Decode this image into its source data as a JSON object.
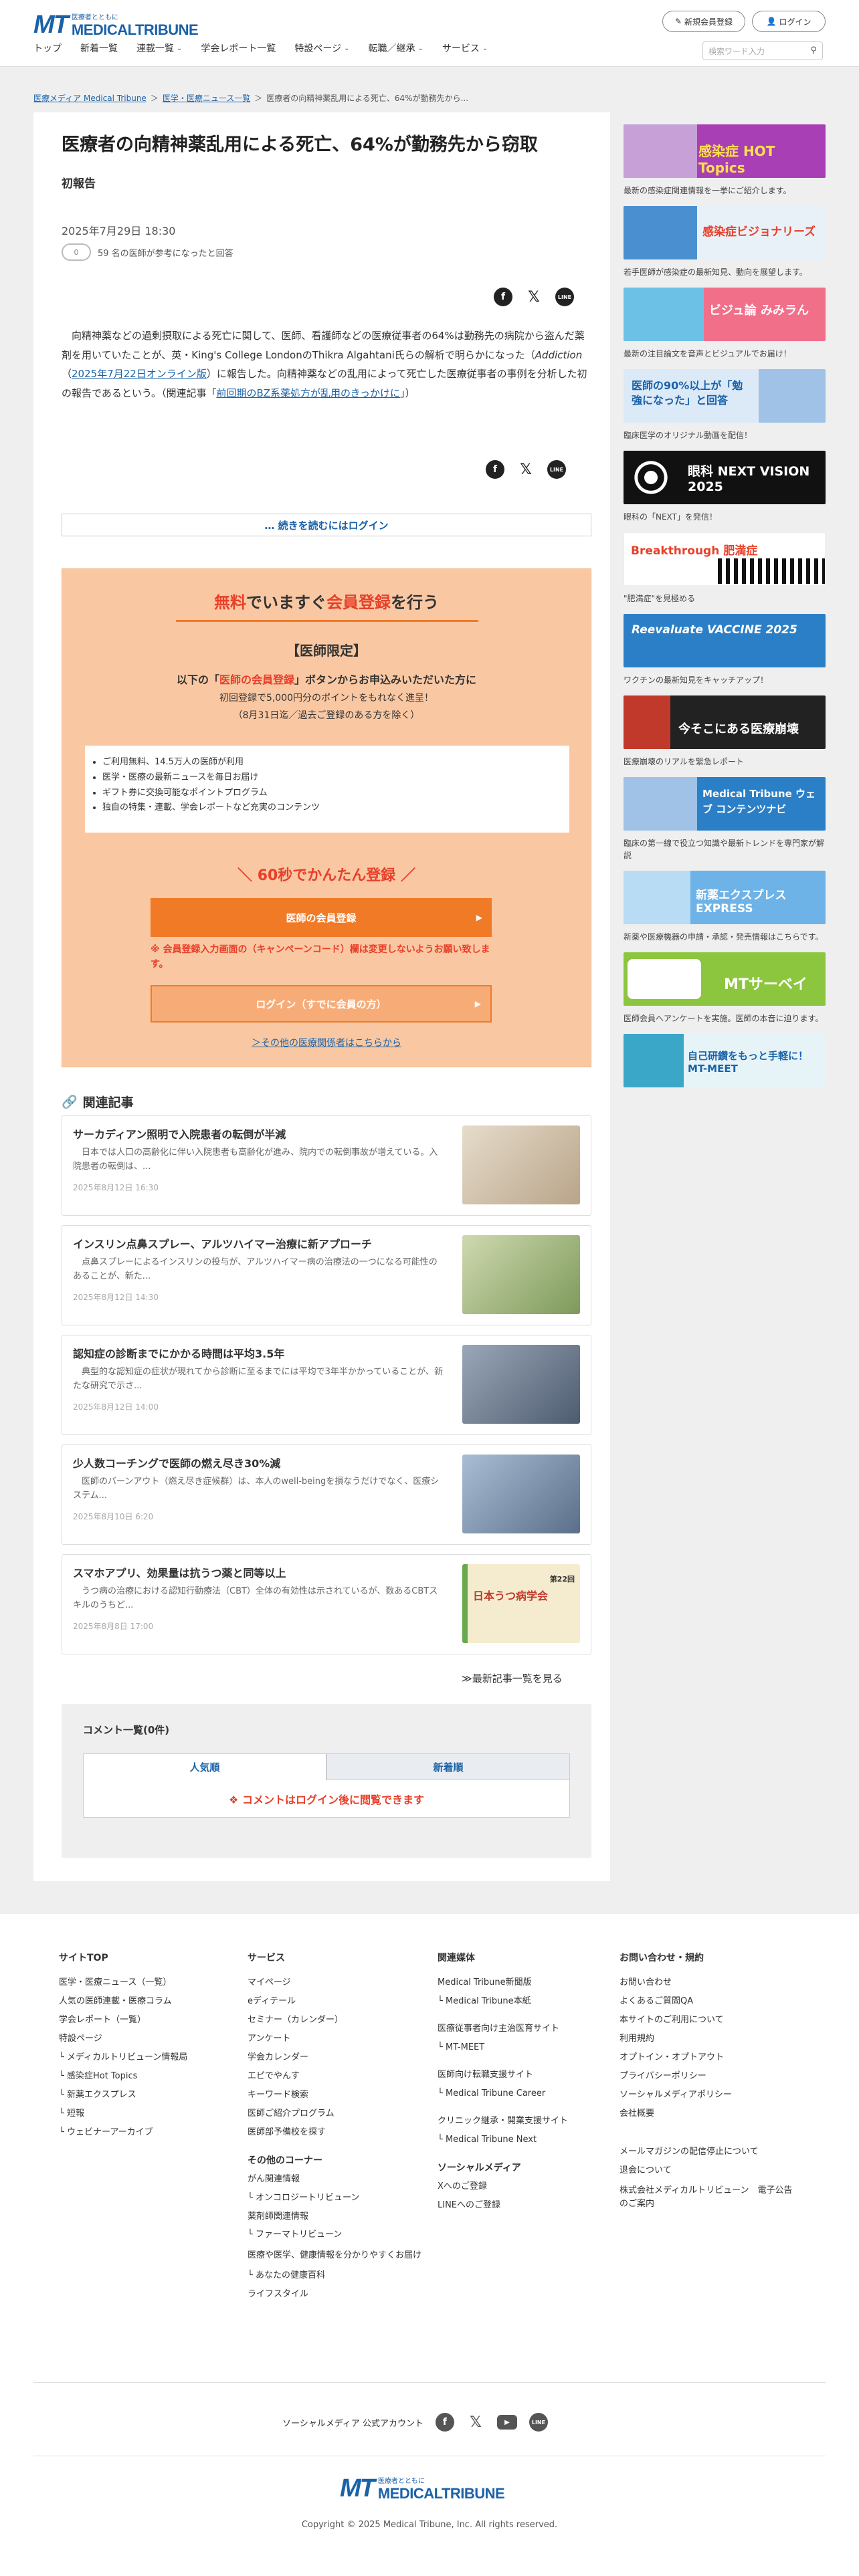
{
  "header": {
    "logo_small": "医療者とともに",
    "logo_mt": "MT",
    "logo_main": "MEDICALTRIBUNE",
    "register_btn": "新規会員登録",
    "login_btn": "ログイン",
    "nav": [
      {
        "label": "トップ",
        "dropdown": false
      },
      {
        "label": "新着一覧",
        "dropdown": false
      },
      {
        "label": "連載一覧",
        "dropdown": true
      },
      {
        "label": "学会レポート一覧",
        "dropdown": false
      },
      {
        "label": "特設ページ",
        "dropdown": true
      },
      {
        "label": "転職／継承",
        "dropdown": true
      },
      {
        "label": "サービス",
        "dropdown": true
      }
    ],
    "search_placeholder": "検索ワード入力",
    "chevron": "⌄"
  },
  "breadcrumb": [
    "医療メディア Medical Tribune",
    "医学・医療ニュース一覧",
    "医療者の向精神薬乱用による死亡、64%が勤務先から..."
  ],
  "breadcrumb_sep": "＞",
  "article": {
    "title": "医療者の向精神薬乱用による死亡、64%が勤務先から窃取",
    "subtitle": "初報告",
    "date": "2025年7月29日 18:30",
    "toggle": "0",
    "reference": "59 名の医師が参考になったと回答",
    "body_1": "向精神薬などの過剰摂取による死亡に関して、医師、看護師などの医療従事者の64%は勤務先の病院から盗んだ薬剤を用いていたことが、英・King's College LondonのThikra Algahtani氏らの解析で明らかになった",
    "body_journal": "Addiction",
    "body_link1": "2025年7月22日オンライン版",
    "body_2": "に報告した。向精神薬などの乱用によって死亡した医療従事者の事例を分析した初の報告であるという。（関連記事「",
    "body_link2": "前回期のBZ系薬処方が乱用のきっかけに",
    "body_3": "」）",
    "read_more_pre": "… 続きを読むには",
    "read_more_link": "ログイン"
  },
  "share": {
    "fb": "f",
    "x": "𝕏",
    "line": "LINE"
  },
  "register": {
    "title_a": "無料",
    "title_b": "でいますぐ",
    "title_c": "会員登録",
    "title_d": "を行う",
    "limited": "【医師限定】",
    "cta_a": "以下の「",
    "cta_b": "医師の会員登録",
    "cta_c": "」ボタンからお申込みいただいた方に",
    "bonus": "初回登録で5,000円分のポイントをもれなく進呈！",
    "period": "（8月31日迄／過去ご登録のある方を除く）",
    "benefits": [
      "ご利用無料、14.5万人の医師が利用",
      "医学・医療の最新ニュースを毎日お届け",
      "ギフト券に交換可能なポイントプログラム",
      "独自の特集・連載、学会レポートなど充実のコンテンツ"
    ],
    "quick": "＼ 60秒でかんたん登録 ／",
    "reg_button": "医師の会員登録",
    "note": "※ 会員登録入力画面の（キャンペーンコード）欄は変更しないようお願い致します。",
    "login_button": "ログイン（すでに会員の方）",
    "other_link": "＞その他の医療関係者はこちらから",
    "arrow": "▶"
  },
  "related": {
    "heading": "関連記事",
    "icon": "🔗",
    "items": [
      {
        "title": "サーカディアン照明で入院患者の転倒が半減",
        "summary": "日本では人口の高齢化に伴い入院患者も高齢化が進み、院内での転倒事故が増えている。入院患者の転倒は、...",
        "date": "2025年8月12日 16:30",
        "color": "#d8c5a8"
      },
      {
        "title": "インスリン点鼻スプレー、アルツハイマー治療に新アプローチ",
        "summary": "点鼻スプレーによるインスリンの投与が、アルツハイマー病の治療法の一つになる可能性のあることが、新た...",
        "date": "2025年8月12日 14:30",
        "color": "#a9b88a"
      },
      {
        "title": "認知症の診断までにかかる時間は平均3.5年",
        "summary": "典型的な認知症の症状が現れてから診断に至るまでには平均で3年半かかっていることが、新たな研究で示さ...",
        "date": "2025年8月12日 14:00",
        "color": "#6f7f95"
      },
      {
        "title": "少人数コーチングで医師の燃え尽き30%減",
        "summary": "医師のバーンアウト（燃え尽き症候群）は、本人のwell-beingを損なうだけでなく、医療システム...",
        "date": "2025年8月10日 6:20",
        "color": "#7a8ea8"
      },
      {
        "title": "スマホアプリ、効果量は抗うつ薬と同等以上",
        "summary": "うつ病の治療における認知行動療法（CBT）全体の有効性は示されているが、数あるCBTスキルのうちど...",
        "date": "2025年8月8日 17:00",
        "color": "#f3ead0"
      }
    ],
    "img5_title": "第22回",
    "img5_main": "日本うつ病学会",
    "more": "≫最新記事一覧を見る"
  },
  "comments": {
    "heading": "コメント一覧(0件)",
    "tab_popular": "人気順",
    "tab_new": "新着順",
    "login_msg": "❖ コメントはログイン後に閲覧できます"
  },
  "sidebar": [
    {
      "title": "感染症 HOT Topics",
      "caption": "最新の感染症関連情報を一挙にご紹介します。",
      "bg": "#a83fb5",
      "fg": "#ffffff"
    },
    {
      "title": "感染症ビジョナリーズ",
      "caption": "若手医師が感染症の最新知見、動向を展望します。",
      "bg": "#e9f1f8",
      "fg": "#e8402a"
    },
    {
      "title": "ビジュ論 みみラん",
      "caption": "最新の注目論文を音声とビジュアルでお届け！",
      "bg": "#f26f8a",
      "fg": "#ffffff"
    },
    {
      "title": "医師の90%以上が「勉強になった」と回答",
      "caption": "臨床医学のオリジナル動画を配信！",
      "bg": "#dceaf8",
      "fg": "#1a62a8"
    },
    {
      "title": "眼科 NEXT VISION 2025",
      "caption": "眼科の「NEXT」を発信！",
      "bg": "#111111",
      "fg": "#ffffff"
    },
    {
      "title": "Breakthrough 肥満症",
      "caption": "\"肥満症\"を見極める",
      "bg": "#ffffff",
      "fg": "#e8402a"
    },
    {
      "title": "Reevaluate VACCINE 2025",
      "caption": "ワクチンの最新知見をキャッチアップ！",
      "bg": "#2b7fc6",
      "fg": "#ffffff"
    },
    {
      "title": "今そこにある医療崩壊",
      "caption": "医療崩壊のリアルを緊急レポート",
      "bg": "#222222",
      "fg": "#ffffff"
    },
    {
      "title": "Medical Tribune ウェブ コンテンツナビ",
      "caption": "臨床の第一線で役立つ知識や最新トレンドを専門家が解説",
      "bg": "#2b7fc6",
      "fg": "#ffffff"
    },
    {
      "title": "新薬エクスプレス EXPRESS",
      "caption": "新薬や医療機器の申請・承認・発売情報はこちらです。",
      "bg": "#6db3e8",
      "fg": "#ffffff"
    },
    {
      "title": "MTサーベイ",
      "caption": "医師会員へアンケートを実施。医師の本音に迫ります。",
      "bg": "#8cc63f",
      "fg": "#ffffff"
    },
    {
      "title": "自己研鑽をもっと手軽に！ MT-MEET",
      "caption": "",
      "bg": "#e6f4f8",
      "fg": "#1a62a8"
    }
  ],
  "footer": {
    "col1": {
      "heading": "サイトTOP",
      "items": [
        "医学・医療ニュース（一覧）",
        "人気の医師連載・医療コラム",
        "学会レポート（一覧）",
        "特設ページ",
        "└ メディカルトリビューン情報局",
        "└ 感染症Hot Topics",
        "└ 新薬エクスプレス",
        "└ 短報",
        "└ ウェビナーアーカイブ"
      ]
    },
    "col2": {
      "heading": "サービス",
      "items": [
        "マイページ",
        "eディテール",
        "セミナー（カレンダー）",
        "アンケート",
        "学会カレンダー",
        "エピでやんす",
        "キーワード検索",
        "医師ご紹介プログラム",
        "医師部予備校を探す"
      ],
      "heading2": "その他のコーナー",
      "items2": [
        "がん関連情報",
        "└ オンコロジートリビューン",
        "薬剤師関連情報",
        "└ ファーマトリビューン",
        "医療や医学、健康情報を分かりやすくお届け",
        "└ あなたの健康百科",
        "ライフスタイル"
      ]
    },
    "col3": {
      "heading": "関連媒体",
      "items": [
        "Medical Tribune新聞版",
        "└ Medical Tribune本紙"
      ],
      "items_b": [
        "医療従事者向け主治医育サイト",
        "└ MT-MEET"
      ],
      "items_c": [
        "医師向け転職支援サイト",
        "└ Medical Tribune Career"
      ],
      "items_d": [
        "クリニック継承・開業支援サイト",
        "└ Medical Tribune Next"
      ],
      "heading2": "ソーシャルメディア",
      "items2": [
        "Xへのご登録",
        "LINEへのご登録"
      ]
    },
    "col4": {
      "heading": "お問い合わせ・規約",
      "items": [
        "お問い合わせ",
        "よくあるご質問QA",
        "本サイトのご利用について",
        "利用規約",
        "オプトイン・オプトアウト",
        "プライバシーポリシー",
        "ソーシャルメディアポリシー",
        "会社概要"
      ],
      "items2": [
        "メールマガジンの配信停止について",
        "退会について",
        "株式会社メディカルトリビューン　電子公告のご案内"
      ]
    },
    "social_label": "ソーシャルメディア 公式アカウント",
    "copyright": "Copyright © 2025 Medical Tribune, Inc. All rights reserved."
  }
}
